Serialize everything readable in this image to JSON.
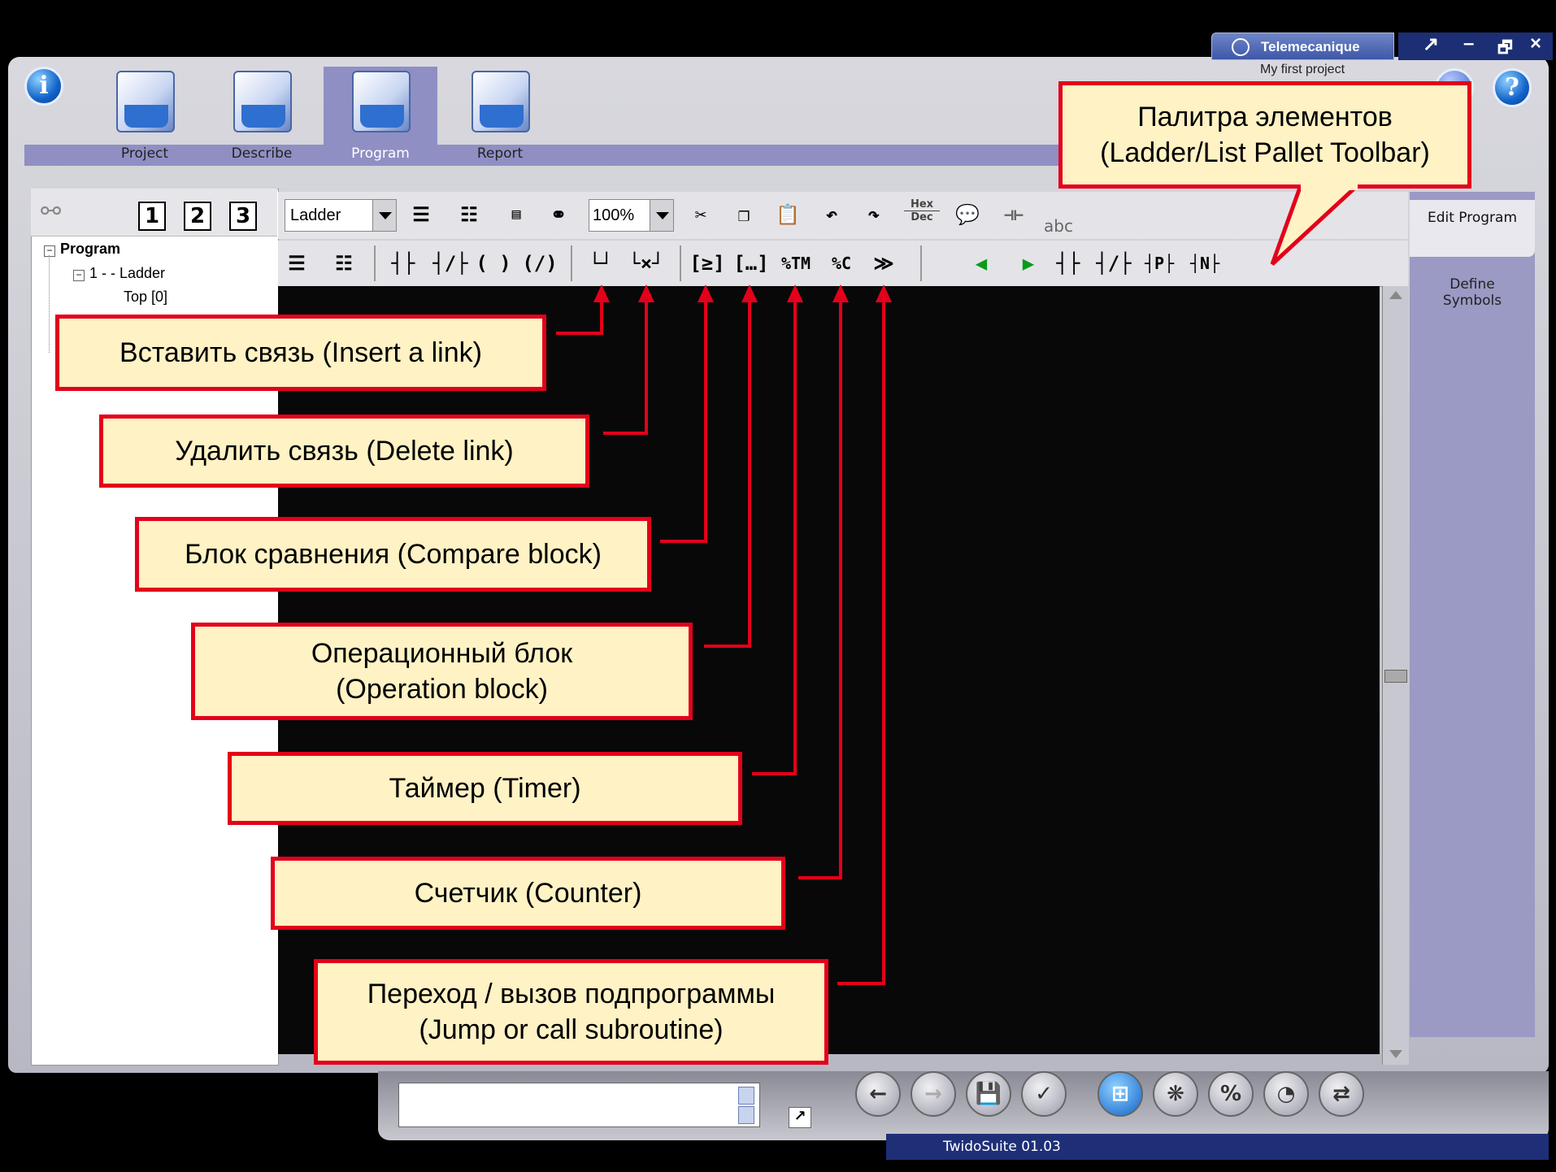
{
  "window": {
    "brand": "Telemecanique",
    "project_name": "My first project",
    "version": "TwidoSuite 01.03",
    "controls": [
      "↗",
      "–",
      "🗗",
      "×"
    ]
  },
  "tabs": [
    {
      "label": "Project"
    },
    {
      "label": "Describe"
    },
    {
      "label": "Program",
      "active": true
    },
    {
      "label": "Report"
    }
  ],
  "left_panel": {
    "numbers": [
      "1",
      "2",
      "3"
    ],
    "tree": {
      "root": "Program",
      "child": "1 -  - Ladder",
      "leaf": "Top [0]"
    }
  },
  "toolbar": {
    "language_select": "Ladder",
    "zoom_select": "100%",
    "hexdec_top": "Hex",
    "hexdec_bottom": "Dec",
    "abc": "abc",
    "timer": "%TM",
    "counter": "%C"
  },
  "right_panel": {
    "edit_program": "Edit Program",
    "define_symbols": "Define Symbols"
  },
  "callouts": {
    "palette": "Палитра элементов (Ladder/List Pallet Toolbar)",
    "insert_link": "Вставить связь (Insert a link)",
    "delete_link": "Удалить связь (Delete link)",
    "compare_block": "Блок сравнения (Compare block)",
    "operation_block": "Операционный блок (Operation block)",
    "timer": "Таймер (Timer)",
    "counter": "Счетчик (Counter)",
    "jump": "Переход / вызов подпрограммы (Jump or call subroutine)"
  },
  "colors": {
    "callout_fill": "#fff2c4",
    "callout_border": "#e3001b",
    "accent_band": "#8f8fc4",
    "version_bar": "#1f2f77"
  }
}
